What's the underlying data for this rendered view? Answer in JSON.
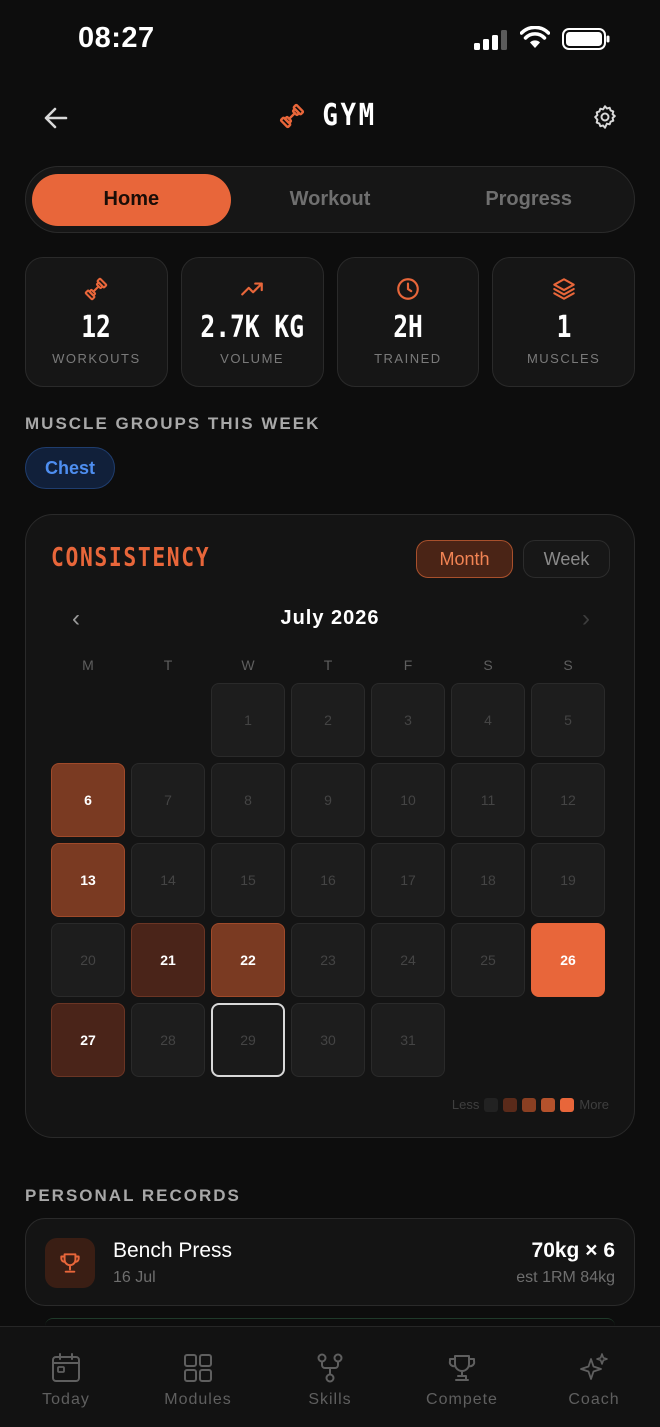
{
  "status": {
    "time": "08:27"
  },
  "header": {
    "title": "GYM",
    "title_icon": "dumbbell-icon"
  },
  "tabs": [
    {
      "label": "Home",
      "active": true
    },
    {
      "label": "Workout",
      "active": false
    },
    {
      "label": "Progress",
      "active": false
    }
  ],
  "stats": [
    {
      "icon": "dumbbell-icon",
      "value": "12",
      "label": "WORKOUTS"
    },
    {
      "icon": "trending-up-icon",
      "value": "2.7K KG",
      "label": "VOLUME"
    },
    {
      "icon": "clock-icon",
      "value": "2H",
      "label": "TRAINED"
    },
    {
      "icon": "layers-icon",
      "value": "1",
      "label": "MUSCLES"
    }
  ],
  "muscle_section": {
    "title": "MUSCLE GROUPS THIS WEEK",
    "chips": [
      "Chest"
    ]
  },
  "consistency": {
    "title": "CONSISTENCY",
    "toggle": {
      "month": "Month",
      "week": "Week",
      "selected": "Month"
    },
    "month_label": "July 2026",
    "prev_icon": "chevron-left-icon",
    "next_icon": "chevron-right-icon",
    "weekdays": [
      "M",
      "T",
      "W",
      "T",
      "F",
      "S",
      "S"
    ],
    "leading_blank_days": 2,
    "days": [
      {
        "d": "1",
        "level": 0
      },
      {
        "d": "2",
        "level": 0
      },
      {
        "d": "3",
        "level": 0
      },
      {
        "d": "4",
        "level": 0
      },
      {
        "d": "5",
        "level": 0
      },
      {
        "d": "6",
        "level": 2
      },
      {
        "d": "7",
        "level": 0
      },
      {
        "d": "8",
        "level": 0
      },
      {
        "d": "9",
        "level": 0
      },
      {
        "d": "10",
        "level": 0
      },
      {
        "d": "11",
        "level": 0
      },
      {
        "d": "12",
        "level": 0
      },
      {
        "d": "13",
        "level": 2
      },
      {
        "d": "14",
        "level": 0
      },
      {
        "d": "15",
        "level": 0
      },
      {
        "d": "16",
        "level": 0
      },
      {
        "d": "17",
        "level": 0
      },
      {
        "d": "18",
        "level": 0
      },
      {
        "d": "19",
        "level": 0
      },
      {
        "d": "20",
        "level": 0
      },
      {
        "d": "21",
        "level": 1
      },
      {
        "d": "22",
        "level": 2
      },
      {
        "d": "23",
        "level": 0
      },
      {
        "d": "24",
        "level": 0
      },
      {
        "d": "25",
        "level": 0
      },
      {
        "d": "26",
        "level": 4
      },
      {
        "d": "27",
        "level": 1
      },
      {
        "d": "28",
        "level": 0
      },
      {
        "d": "29",
        "level": 0,
        "today": true
      },
      {
        "d": "30",
        "level": 0
      },
      {
        "d": "31",
        "level": 0
      }
    ],
    "legend": {
      "less": "Less",
      "more": "More",
      "colors": [
        "#222222",
        "#5a2a1a",
        "#8a3f22",
        "#b5522c",
        "#e8663a"
      ]
    }
  },
  "records_section": {
    "title": "PERSONAL RECORDS",
    "items": [
      {
        "icon": "trophy-icon",
        "name": "Bench Press",
        "date": "16 Jul",
        "value": "70kg × 6",
        "estimate": "est 1RM 84kg"
      }
    ]
  },
  "bottom_nav": [
    {
      "icon": "calendar-icon",
      "label": "Today"
    },
    {
      "icon": "grid-icon",
      "label": "Modules"
    },
    {
      "icon": "skills-branch-icon",
      "label": "Skills"
    },
    {
      "icon": "trophy-icon",
      "label": "Compete"
    },
    {
      "icon": "sparkles-icon",
      "label": "Coach"
    }
  ],
  "colors": {
    "accent": "#e8663a",
    "background": "#0d0d0d",
    "chip_blue": "#4e8ef0"
  }
}
